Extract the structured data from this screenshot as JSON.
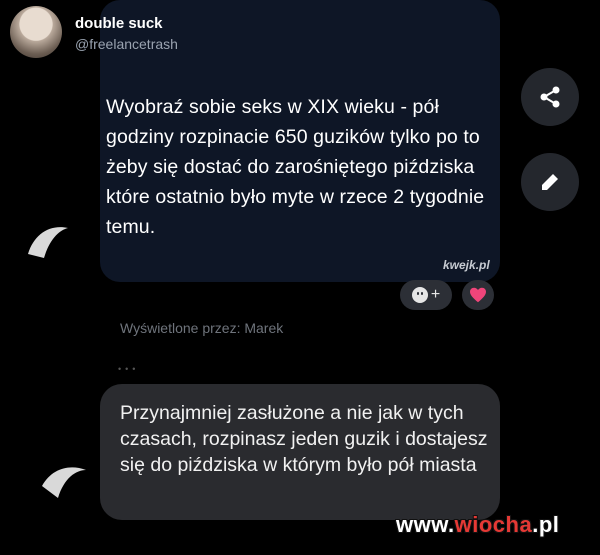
{
  "tweet": {
    "author": "double suck",
    "handle": "@freelancetrash",
    "text": "Wyobraź sobie seks w XIX wieku - pół godziny rozpinacie 650 guzików tylko po to żeby się dostać do zarośniętego piździska które ostatnio było myte w rzece 2 tygodnie temu.",
    "watermark": "kwejk.pl"
  },
  "reactions": {
    "add_label": "+",
    "heart_icon": "heart-icon"
  },
  "actions": {
    "share_icon": "share-icon",
    "edit_icon": "pencil-icon"
  },
  "seen_by": "Wyświetlone przez: Marek",
  "reply": {
    "text": "Przynajmniej zasłużone a nie jak w tych czasach, rozpinasz jeden guzik i dostajesz się do piździska w którym było pół miasta"
  },
  "site_watermark": {
    "prefix": "www.",
    "name": "wiocha",
    "suffix": ".pl"
  },
  "colors": {
    "background": "#000000",
    "tweet_card": "#0e1626",
    "bubble": "#2a2b2f",
    "heart": "#f0457a",
    "watermark_red": "#e53935"
  }
}
